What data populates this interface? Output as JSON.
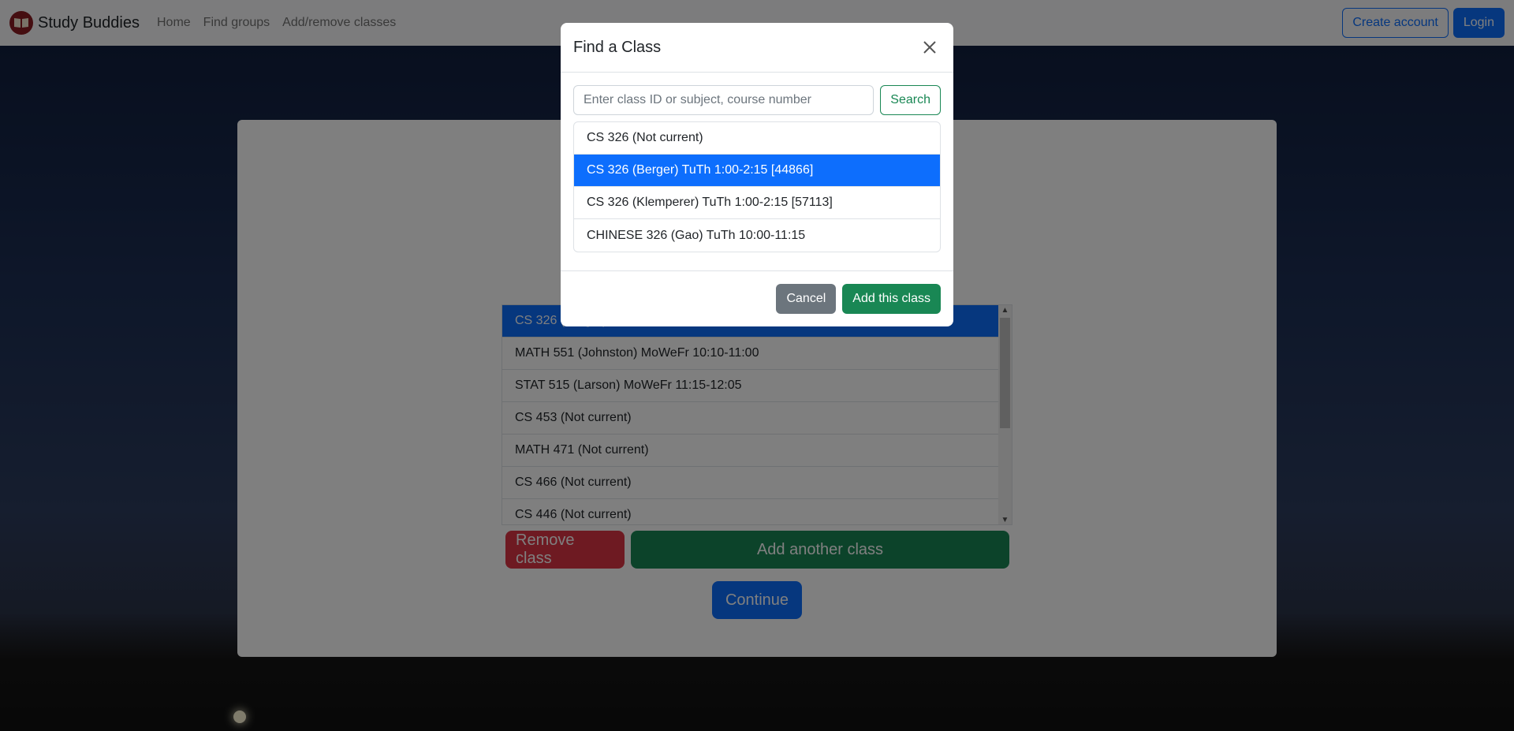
{
  "navbar": {
    "brand": "Study Buddies",
    "logo_icon": "book-icon",
    "links": [
      "Home",
      "Find groups",
      "Add/remove classes"
    ],
    "create_account": "Create account",
    "login": "Login"
  },
  "class_list": {
    "items": [
      {
        "label": "CS 326 (Berger)",
        "selected": true
      },
      {
        "label": "MATH 551 (Johnston) MoWeFr 10:10-11:00",
        "selected": false
      },
      {
        "label": "STAT 515 (Larson) MoWeFr 11:15-12:05",
        "selected": false
      },
      {
        "label": "CS 453 (Not current)",
        "selected": false
      },
      {
        "label": "MATH 471 (Not current)",
        "selected": false
      },
      {
        "label": "CS 466 (Not current)",
        "selected": false
      },
      {
        "label": "CS 446 (Not current)",
        "selected": false
      }
    ],
    "remove_button": "Remove class",
    "add_button": "Add another class",
    "continue_button": "Continue"
  },
  "modal": {
    "title": "Find a Class",
    "search_placeholder": "Enter class ID or subject, course number",
    "search_value": "",
    "search_button": "Search",
    "results": [
      {
        "label": "CS 326 (Not current)",
        "selected": false
      },
      {
        "label": "CS 326 (Berger) TuTh 1:00-2:15 [44866]",
        "selected": true
      },
      {
        "label": "CS 326 (Klemperer) TuTh 1:00-2:15 [57113]",
        "selected": false
      },
      {
        "label": "CHINESE 326 (Gao) TuTh 10:00-11:15",
        "selected": false
      }
    ],
    "cancel_button": "Cancel",
    "add_button": "Add this class"
  },
  "colors": {
    "primary": "#0d6efd",
    "success": "#198754",
    "danger": "#dc3545",
    "secondary": "#6c757d",
    "brand_logo": "#8b1c23"
  }
}
